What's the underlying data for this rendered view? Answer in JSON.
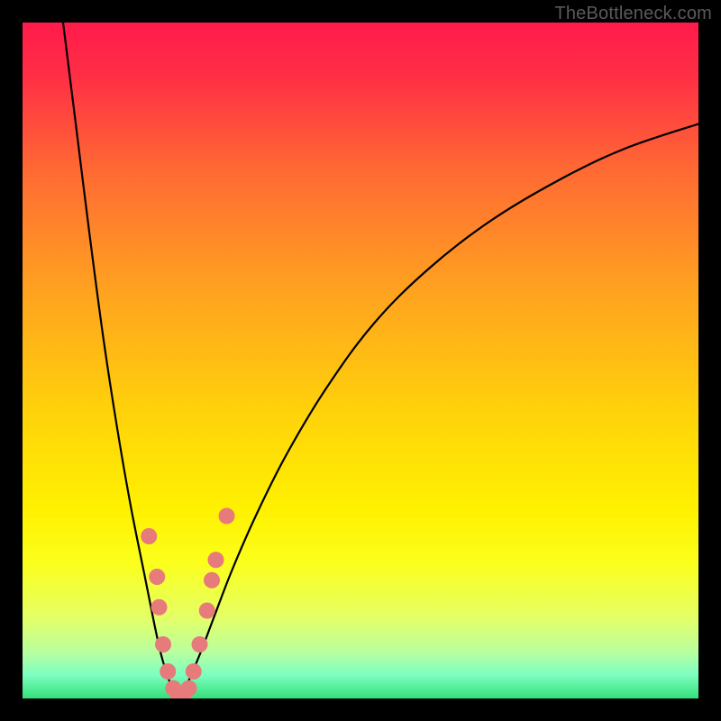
{
  "watermark": "TheBottleneck.com",
  "chart_data": {
    "type": "line",
    "title": "",
    "xlabel": "",
    "ylabel": "",
    "xlim": [
      0,
      100
    ],
    "ylim": [
      0,
      100
    ],
    "gradient_stops": [
      {
        "offset": 0.0,
        "color": "#ff1a4b"
      },
      {
        "offset": 0.08,
        "color": "#ff2f45"
      },
      {
        "offset": 0.22,
        "color": "#ff6a33"
      },
      {
        "offset": 0.4,
        "color": "#ffa31f"
      },
      {
        "offset": 0.58,
        "color": "#ffd30a"
      },
      {
        "offset": 0.72,
        "color": "#fff100"
      },
      {
        "offset": 0.8,
        "color": "#fbff1c"
      },
      {
        "offset": 0.88,
        "color": "#e4ff66"
      },
      {
        "offset": 0.93,
        "color": "#baff9e"
      },
      {
        "offset": 0.965,
        "color": "#7dffc0"
      },
      {
        "offset": 1.0,
        "color": "#34e07a"
      }
    ],
    "series": [
      {
        "name": "left-branch",
        "x": [
          6.0,
          8.0,
          10.0,
          12.0,
          14.0,
          16.0,
          18.0,
          19.5,
          20.5,
          21.5,
          22.3,
          23.0
        ],
        "y": [
          100.0,
          84.0,
          68.0,
          53.0,
          40.0,
          28.5,
          18.5,
          11.0,
          6.5,
          3.2,
          1.2,
          0.2
        ]
      },
      {
        "name": "right-branch",
        "x": [
          23.0,
          24.0,
          25.0,
          26.5,
          28.5,
          31.0,
          34.5,
          39.0,
          45.0,
          52.0,
          60.0,
          69.0,
          79.0,
          89.0,
          100.0
        ],
        "y": [
          0.2,
          1.4,
          3.6,
          7.2,
          12.5,
          19.0,
          27.0,
          36.0,
          46.0,
          55.5,
          63.5,
          70.5,
          76.5,
          81.3,
          85.0
        ]
      }
    ],
    "markers": {
      "name": "highlight-dots",
      "color": "#e77a7a",
      "radius": 9,
      "points": [
        {
          "x": 18.7,
          "y": 24.0
        },
        {
          "x": 19.9,
          "y": 18.0
        },
        {
          "x": 20.2,
          "y": 13.5
        },
        {
          "x": 20.8,
          "y": 8.0
        },
        {
          "x": 21.5,
          "y": 4.0
        },
        {
          "x": 22.3,
          "y": 1.5
        },
        {
          "x": 23.0,
          "y": 0.5
        },
        {
          "x": 23.8,
          "y": 0.5
        },
        {
          "x": 24.6,
          "y": 1.5
        },
        {
          "x": 25.3,
          "y": 4.0
        },
        {
          "x": 26.2,
          "y": 8.0
        },
        {
          "x": 27.3,
          "y": 13.0
        },
        {
          "x": 28.0,
          "y": 17.5
        },
        {
          "x": 28.6,
          "y": 20.5
        },
        {
          "x": 30.2,
          "y": 27.0
        }
      ]
    }
  }
}
